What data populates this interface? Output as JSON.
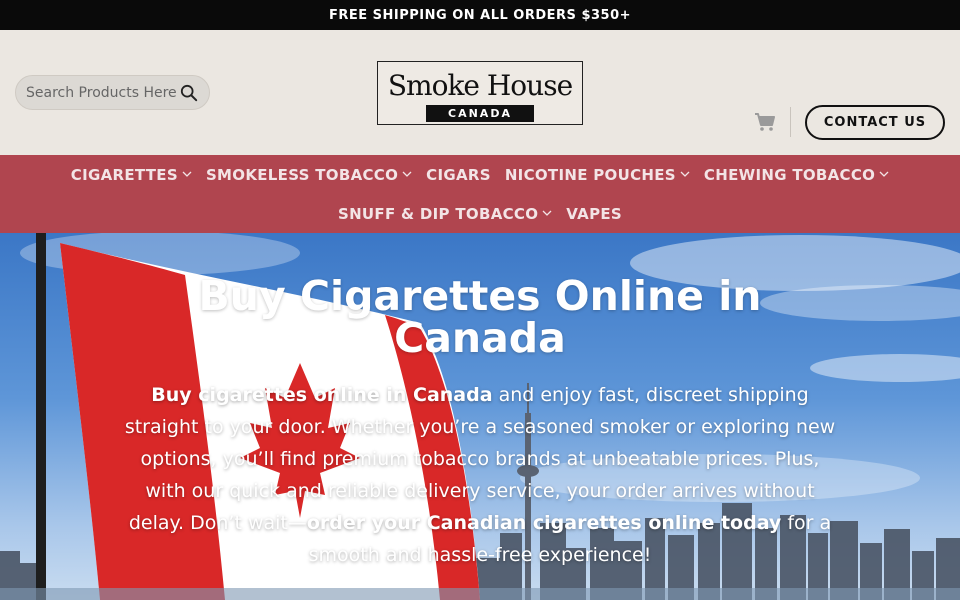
{
  "topbar": {
    "text": "FREE SHIPPING ON ALL ORDERS $350+"
  },
  "header": {
    "search_placeholder": "Search Products Here...",
    "logo_main": "Smoke House",
    "logo_sub": "CANADA",
    "contact_label": "CONTACT US",
    "icons": [
      "search-icon",
      "cart-icon"
    ]
  },
  "nav": {
    "row1": [
      {
        "label": "CIGARETTES",
        "dropdown": true
      },
      {
        "label": "SMOKELESS TOBACCO",
        "dropdown": true
      },
      {
        "label": "CIGARS",
        "dropdown": false
      },
      {
        "label": "NICOTINE POUCHES",
        "dropdown": true
      },
      {
        "label": "CHEWING TOBACCO",
        "dropdown": true
      }
    ],
    "row2": [
      {
        "label": "SNUFF & DIP TOBACCO",
        "dropdown": true
      },
      {
        "label": "VAPES",
        "dropdown": false
      }
    ]
  },
  "hero": {
    "title": "Buy Cigarettes Online in Canada",
    "p_bold1": "Buy cigarettes online in Canada",
    "p_text1": " and enjoy fast, discreet shipping straight to your door. Whether you’re a seasoned smoker or exploring new options, you’ll find premium tobacco brands at unbeatable prices. Plus, with our quick and reliable delivery service, your order arrives without delay. Don’t wait—",
    "p_bold2": "order your Canadian cigarettes online today",
    "p_text2": " for a smooth and hassle-free experience!"
  },
  "colors": {
    "topbar_bg": "#0a0a0a",
    "header_bg": "#ebe7e1",
    "nav_bg": "#b0454f",
    "nav_text": "#f3e4e6",
    "flag_red": "#d92828"
  }
}
